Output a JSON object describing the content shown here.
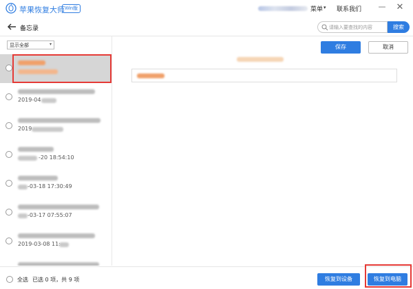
{
  "titlebar": {
    "app_title": "苹果恢复大师",
    "edition_badge": "Win版",
    "menu_label": "菜单",
    "menu_caret": "▾",
    "contact_label": "联系我们",
    "minimize_glyph": "—",
    "close_glyph": "✕"
  },
  "header": {
    "back_icon": "arrow-left-icon",
    "page_title": "备忘录",
    "search_placeholder": "请输入要查找的内容",
    "search_button": "搜索"
  },
  "sidebar": {
    "filter_value": "显示全部",
    "filter_caret": "▾",
    "items": [
      {
        "date_suffix": ""
      },
      {
        "date_suffix": ""
      },
      {
        "date_suffix": ""
      },
      {
        "date_suffix": "-20 18:54:10"
      },
      {
        "date_suffix": "-03-18 17:30:49"
      },
      {
        "date_suffix": "-03-17 07:55:07"
      },
      {
        "date_suffix": ""
      },
      {
        "date_suffix": ""
      }
    ],
    "item2_date": "2019-04",
    "item3_date": "2019",
    "item7_date": "2019-03-08 11:"
  },
  "editor": {
    "save_button": "保存",
    "cancel_button": "取消"
  },
  "footer": {
    "select_all": "全选",
    "count_text": "已选 0 项，共 9 项",
    "restore_device_button": "恢复到设备",
    "restore_pc_button": "恢复到电脑"
  },
  "colors": {
    "accent": "#2f7de1",
    "highlight": "#e53935",
    "selected_row": "#d6d6d6"
  }
}
